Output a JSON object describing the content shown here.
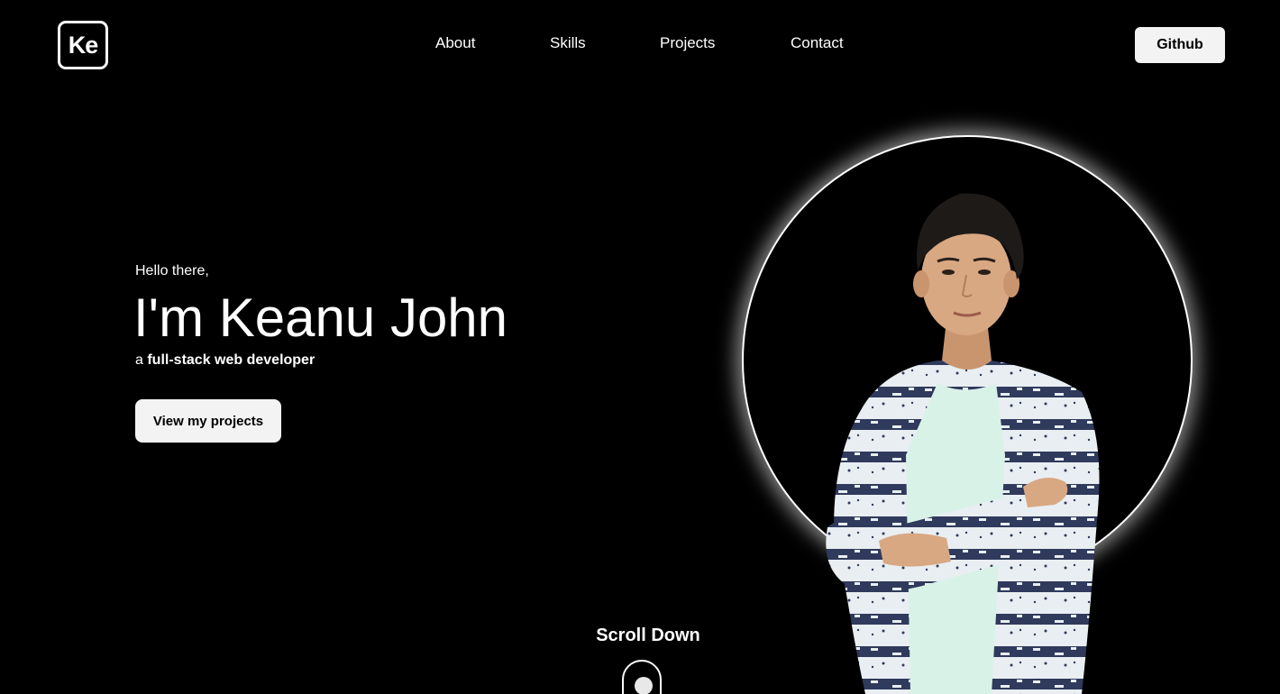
{
  "header": {
    "logo_text": "Ke",
    "nav": [
      {
        "label": "About"
      },
      {
        "label": "Skills"
      },
      {
        "label": "Projects"
      },
      {
        "label": "Contact"
      }
    ],
    "github_label": "Github"
  },
  "hero": {
    "greeting": "Hello there,",
    "name": "I'm Keanu John",
    "tagline_prefix": "a ",
    "tagline_bold": "full-stack web developer",
    "cta_label": "View my projects"
  },
  "scroll": {
    "label": "Scroll Down",
    "icon": "mouse-scroll-icon"
  },
  "colors": {
    "background": "#000000",
    "text": "#ffffff",
    "button_bg": "#f3f3f4",
    "button_text": "#000000",
    "shirt_light": "#e9eef2",
    "shirt_dark": "#2f3a5c",
    "tshirt": "#d9f2e8",
    "skin": "#d8a882",
    "hair": "#1e1a18"
  }
}
